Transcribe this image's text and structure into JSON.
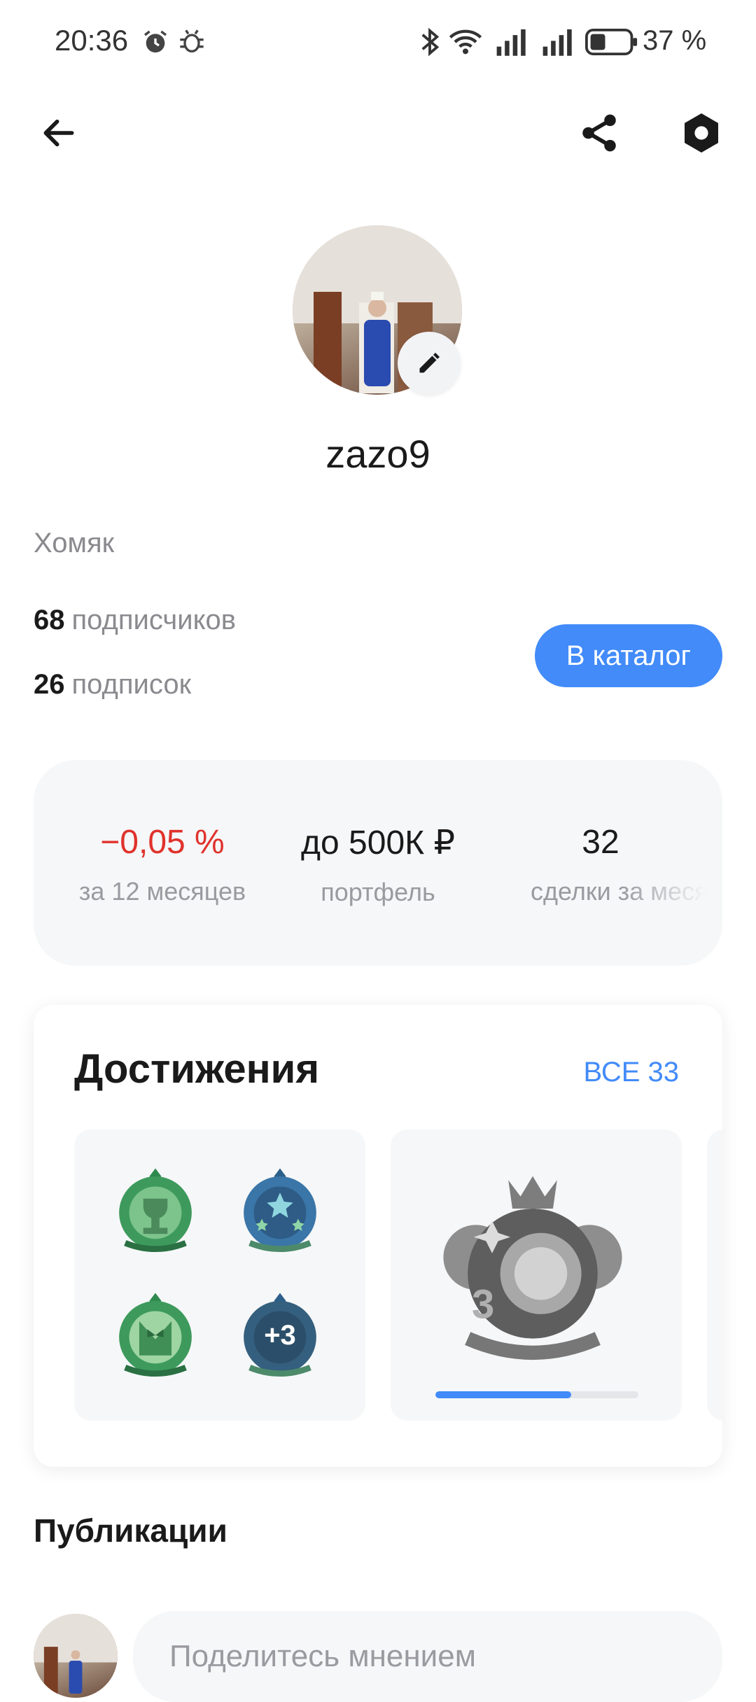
{
  "status_bar": {
    "time": "20:36",
    "battery": "37 %"
  },
  "profile": {
    "username": "zazo9",
    "bio": "Хомяк",
    "followers_count": "68",
    "followers_label": "подписчиков",
    "following_count": "26",
    "following_label": "подписок",
    "catalog_button": "В каталог"
  },
  "stats": [
    {
      "value": "−0,05 %",
      "label": "за 12 месяцев",
      "color": "#e0322c"
    },
    {
      "value": "до 500К ₽",
      "label": "портфель",
      "color": "#1a1a1a"
    },
    {
      "value": "32",
      "label": "сделки за месяц",
      "color": "#1a1a1a"
    }
  ],
  "achievements": {
    "title": "Достижения",
    "all_link": "ВСЕ 33",
    "badge_plus": "+3",
    "progress": 0.67
  },
  "publications": {
    "title": "Публикации",
    "placeholder": "Поделитесь мнением"
  },
  "icons": [
    "alarm-icon",
    "debug-icon",
    "bluetooth-icon",
    "wifi-icon",
    "signal-icon",
    "battery-icon",
    "back-arrow-icon",
    "share-icon",
    "settings-hexagon-icon",
    "pencil-icon"
  ]
}
